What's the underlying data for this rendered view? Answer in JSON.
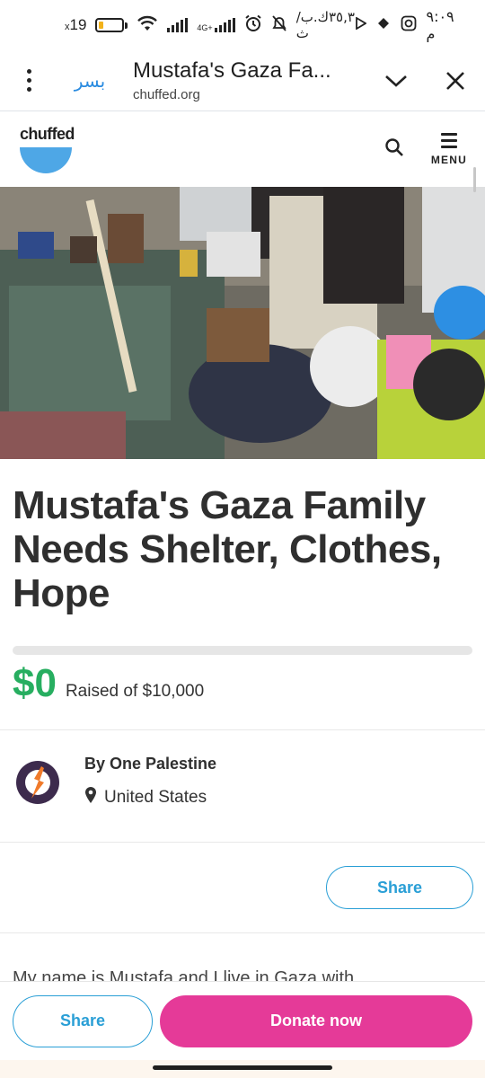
{
  "status_bar": {
    "time": "٩:٠٩ م",
    "speed": "٣٥,٣ك.ب/ث",
    "network_type": "4G+",
    "battery_level": "19",
    "battery_fraction": 0.19
  },
  "browser": {
    "extension_label": "بسر",
    "page_title": "Mustafa's Gaza Fa...",
    "domain": "chuffed.org",
    "icons": [
      "more-vert-icon",
      "chevron-down-icon",
      "close-icon"
    ]
  },
  "site": {
    "logo_text": "chuffed",
    "menu_label": "MENU",
    "brand_color": "#4ea7e6"
  },
  "campaign": {
    "title": "Mustafa's Gaza Family Needs Shelter, Clothes, Hope",
    "raised_amount": "$0",
    "raised_label": "Raised of $10,000",
    "progress_fraction": 0,
    "organizer_name": "By One Palestine",
    "location": "United States",
    "share_label": "Share",
    "body_preview": "My name is Mustafa and I live in Gaza with"
  },
  "bottom_bar": {
    "share_label": "Share",
    "donate_label": "Donate now",
    "donate_color": "#e53a98",
    "share_color": "#2a9fd6"
  }
}
